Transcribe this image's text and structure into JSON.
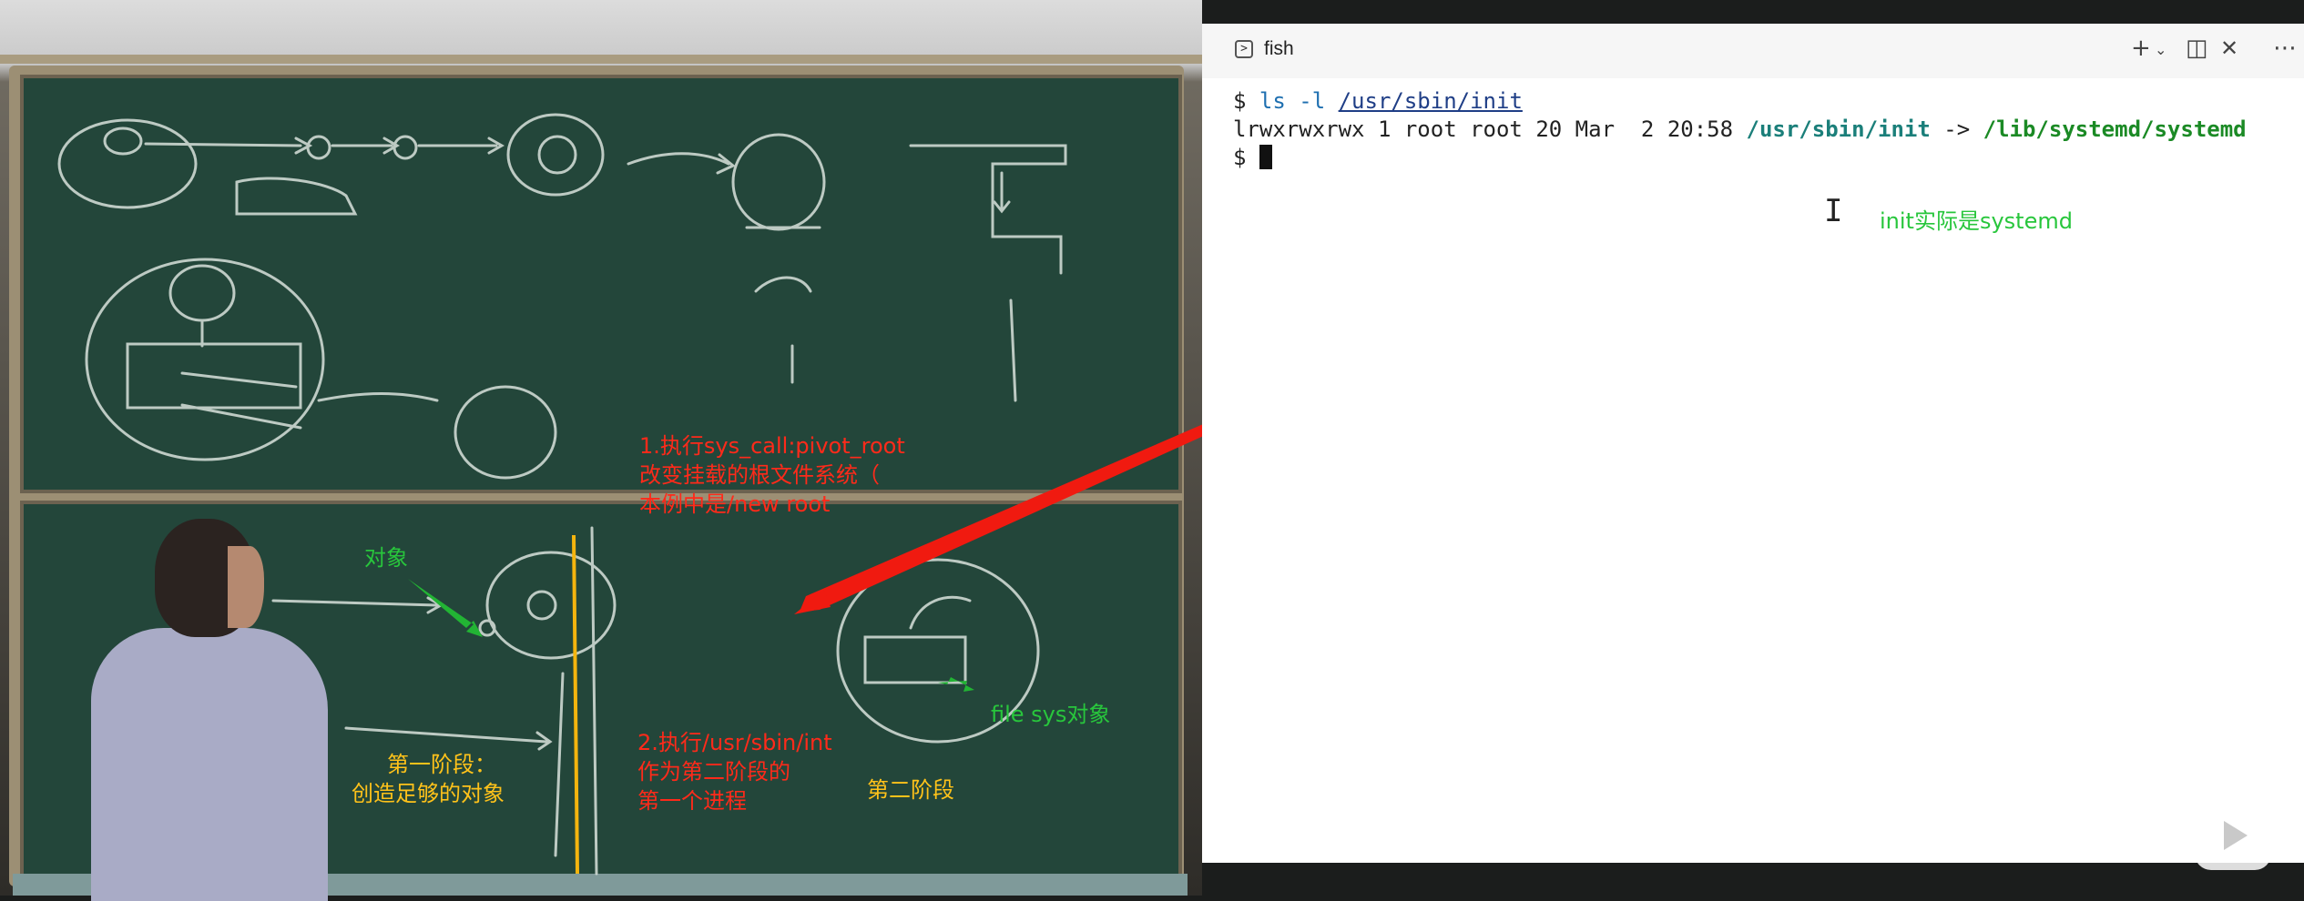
{
  "terminal": {
    "tab_title": "fish",
    "tab_icon": "terminal-icon",
    "toolbar_icons": [
      "plus-icon",
      "chevron-down-icon",
      "split-pane-icon",
      "close-icon",
      "more-icon"
    ],
    "prompt": "$",
    "command_name": "ls -l",
    "command_arg": "/usr/sbin/init",
    "output_perm": "lrwxrwxrwx 1 root root 20 Mar  2 20:58 ",
    "output_link": "/usr/sbin/init",
    "output_arrow": " -> ",
    "output_target": "/lib/systemd/systemd"
  },
  "annotations": {
    "init_is_systemd": "init实际是systemd",
    "step1_line1": "1.执行sys_call:pivot_root",
    "step1_line2": "改变挂载的根文件系统（",
    "step1_line3": "本例中是/new root",
    "object_label": "对象",
    "file_sys_label": "file sys对象",
    "stage1_line1": "第一阶段：",
    "stage1_line2": "创造足够的对象",
    "step2_line1": "2.执行/usr/sbin/int",
    "step2_line2": "作为第二阶段的",
    "step2_line3": "第一个进程",
    "stage2": "第二阶段"
  },
  "colors": {
    "annotation_red": "#ff2a1a",
    "annotation_green": "#28c63c",
    "annotation_yellow": "#ffc21a",
    "chalkboard": "#23463a"
  }
}
